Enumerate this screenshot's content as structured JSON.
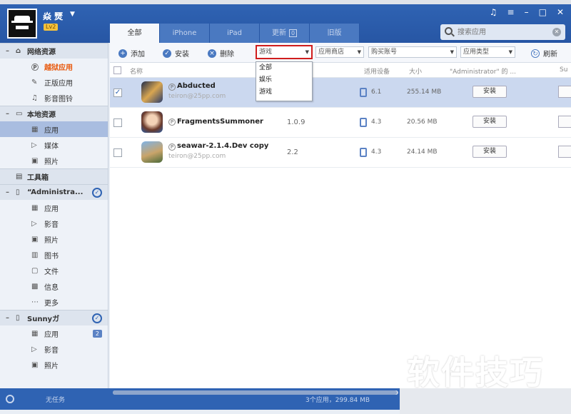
{
  "header": {
    "username": "焱 燹",
    "level": "Lv2",
    "tabs": [
      {
        "label": "全部",
        "active": true
      },
      {
        "label": "iPhone"
      },
      {
        "label": "iPad"
      },
      {
        "label": "更新",
        "count": "0"
      },
      {
        "label": "旧版"
      }
    ],
    "search_placeholder": "搜索应用",
    "window_controls": [
      "music-icon",
      "menu-icon",
      "minimize-icon",
      "maximize-icon",
      "close-icon"
    ]
  },
  "sidebar": {
    "network": {
      "title": "网络资源",
      "items": [
        "越狱应用",
        "正版应用",
        "影音图铃"
      ]
    },
    "local": {
      "title": "本地资源",
      "items": [
        "应用",
        "媒体",
        "照片"
      ]
    },
    "toolbox": "工具箱",
    "device1": {
      "title": "“Administra...",
      "items": [
        "应用",
        "影音",
        "照片",
        "图书",
        "文件",
        "信息",
        "更多"
      ]
    },
    "device2": {
      "title": "Sunnyガ",
      "items": [
        "应用",
        "影音",
        "照片"
      ],
      "app_badge": "2"
    }
  },
  "toolbar": {
    "add": "添加",
    "install": "安装",
    "delete": "删除",
    "type_filter": "游戏",
    "store_filter": "应用商店",
    "account_filter": "购买账号",
    "app_type_filter": "应用类型",
    "refresh": "刷新"
  },
  "dropdown_options": [
    "全部",
    "娱乐",
    "游戏"
  ],
  "table": {
    "headers": {
      "name": "名称",
      "device": "适用设备",
      "size": "大小",
      "owner": "\"Administrator\" 的 ...",
      "extra": "Su"
    },
    "rows": [
      {
        "name": "Abducted",
        "author": "teiron@25pp.com",
        "version": "",
        "compat": "6.1",
        "size": "255.14 MB",
        "action": "安装",
        "selected": true
      },
      {
        "name": "FragmentsSummoner",
        "author": "",
        "version": "1.0.9",
        "compat": "4.3",
        "size": "20.56 MB",
        "action": "安装",
        "selected": false
      },
      {
        "name": "seawar-2.1.4.Dev copy",
        "author": "teiron@25pp.com",
        "version": "2.2",
        "compat": "4.3",
        "size": "24.14 MB",
        "action": "安装",
        "selected": false
      }
    ]
  },
  "footer": {
    "task": "无任务",
    "summary": "3个应用，299.84 MB"
  },
  "watermark": "软件技巧",
  "colors": {
    "header_blue": "#2f63b3",
    "selected_row": "#cbd8ef",
    "highlight_red": "#d01d1d",
    "jailbreak_orange": "#e8580c"
  }
}
